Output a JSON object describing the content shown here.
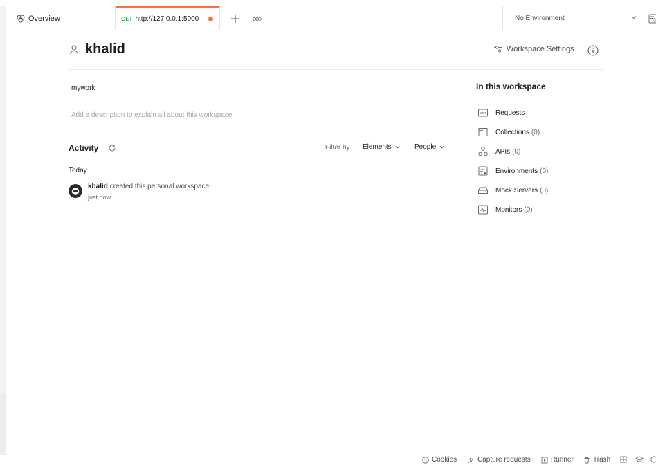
{
  "tabs": {
    "overview_label": "Overview",
    "request_method": "GET",
    "request_url": "http://127.0.0.1:5000",
    "more_label": "ooo",
    "environment": "No Environment"
  },
  "workspace": {
    "name": "khalid",
    "settings_label": "Workspace Settings",
    "summary": "mywork",
    "description_placeholder": "Add a description to explain all about this workspace"
  },
  "activity": {
    "title": "Activity",
    "filter_by": "Filter by",
    "filter_elements": "Elements",
    "filter_people": "People",
    "group_label": "Today",
    "items": [
      {
        "user": "khalid",
        "action": "created this personal workspace",
        "time": "just now"
      }
    ]
  },
  "in_workspace": {
    "title": "In this workspace",
    "items": [
      {
        "label": "Requests",
        "count": "",
        "icon": "requests-icon"
      },
      {
        "label": "Collections",
        "count": "(0)",
        "icon": "collections-icon"
      },
      {
        "label": "APIs",
        "count": "(0)",
        "icon": "apis-icon"
      },
      {
        "label": "Environments",
        "count": "(0)",
        "icon": "environments-icon"
      },
      {
        "label": "Mock Servers",
        "count": "(0)",
        "icon": "mock-servers-icon"
      },
      {
        "label": "Monitors",
        "count": "(0)",
        "icon": "monitors-icon"
      }
    ]
  },
  "statusbar": {
    "cookies": "Cookies",
    "capture": "Capture requests",
    "runner": "Runner",
    "trash": "Trash"
  },
  "colors": {
    "accent": "#ff6c37",
    "get_method": "#0cbb52",
    "muted_text": "#a6a6a6"
  }
}
